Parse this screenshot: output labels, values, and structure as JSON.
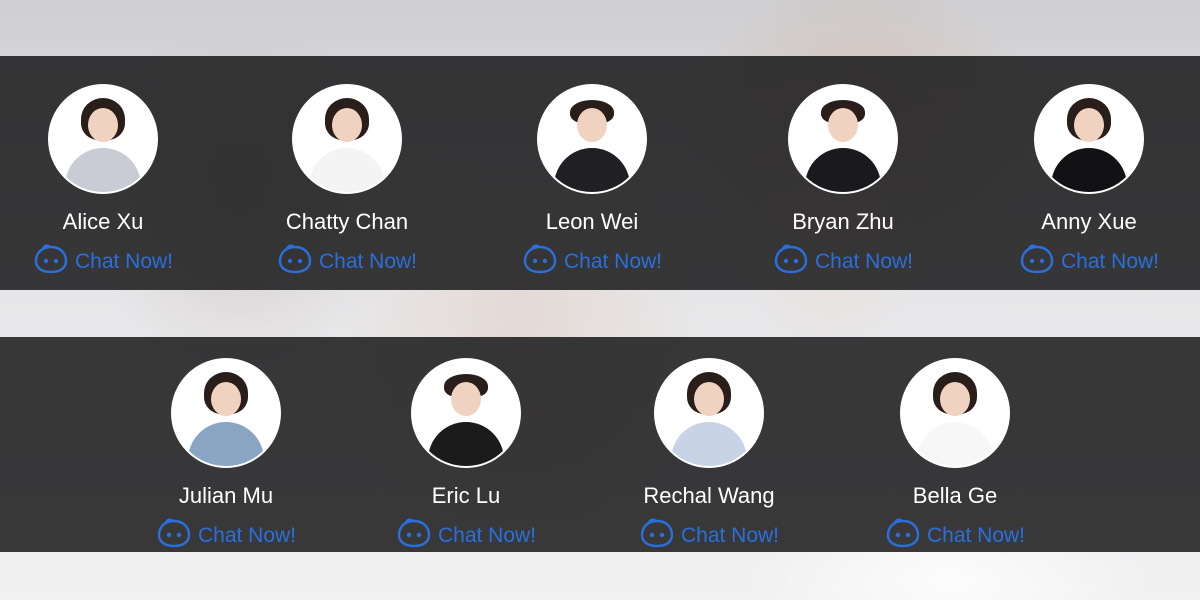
{
  "agents_row1": [
    {
      "name": "Alice Xu",
      "chat_label": "Chat Now!",
      "body_color": "#c9ccd4",
      "hair": "long"
    },
    {
      "name": "Chatty Chan",
      "chat_label": "Chat Now!",
      "body_color": "#f4f4f4",
      "hair": "long"
    },
    {
      "name": "Leon Wei",
      "chat_label": "Chat Now!",
      "body_color": "#1f1f24",
      "hair": "short"
    },
    {
      "name": "Bryan Zhu",
      "chat_label": "Chat Now!",
      "body_color": "#1a1a1e",
      "hair": "short"
    },
    {
      "name": "Anny Xue",
      "chat_label": "Chat Now!",
      "body_color": "#121214",
      "hair": "long"
    }
  ],
  "agents_row2": [
    {
      "name": "Julian Mu",
      "chat_label": "Chat Now!",
      "body_color": "#8aa5c4",
      "hair": "long"
    },
    {
      "name": "Eric Lu",
      "chat_label": "Chat Now!",
      "body_color": "#1b1b1b",
      "hair": "short"
    },
    {
      "name": "Rechal Wang",
      "chat_label": "Chat Now!",
      "body_color": "#c8d3e6",
      "hair": "long"
    },
    {
      "name": "Bella Ge",
      "chat_label": "Chat Now!",
      "body_color": "#f7f7f7",
      "hair": "long"
    }
  ],
  "accent_color": "#2a6fdc"
}
